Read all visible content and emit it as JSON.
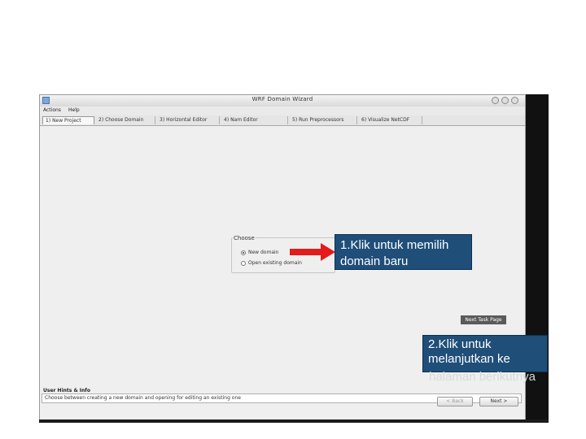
{
  "window": {
    "title": "WRF Domain Wizard",
    "menu": [
      "Actions",
      "Help"
    ],
    "tabs": [
      "1) New Project",
      "2) Choose Domain",
      "3) Horizontal Editor",
      "4) Nam Editor",
      "5) Run Preprocessors",
      "6) Visualize NetCDF"
    ],
    "choose": {
      "label": "Choose",
      "options": [
        {
          "label": "New domain",
          "selected": true
        },
        {
          "label": "Open existing domain",
          "selected": false
        }
      ]
    },
    "hints_title": "User Hints & Info",
    "hints_text": "Choose between creating a new domain and opening for editing an existing one",
    "back_label": "< Back",
    "next_label": "Next >",
    "status_chip": "Next Task Page"
  },
  "callouts": {
    "c1": "1.Klik untuk memilih domain baru",
    "c2_line1": "2.Klik untuk",
    "c2_line2": "melanjutkan ke",
    "c2_line3": "halaman berikutnya"
  },
  "colors": {
    "callout_bg": "#1f4e79",
    "arrow": "#e31b1b"
  }
}
